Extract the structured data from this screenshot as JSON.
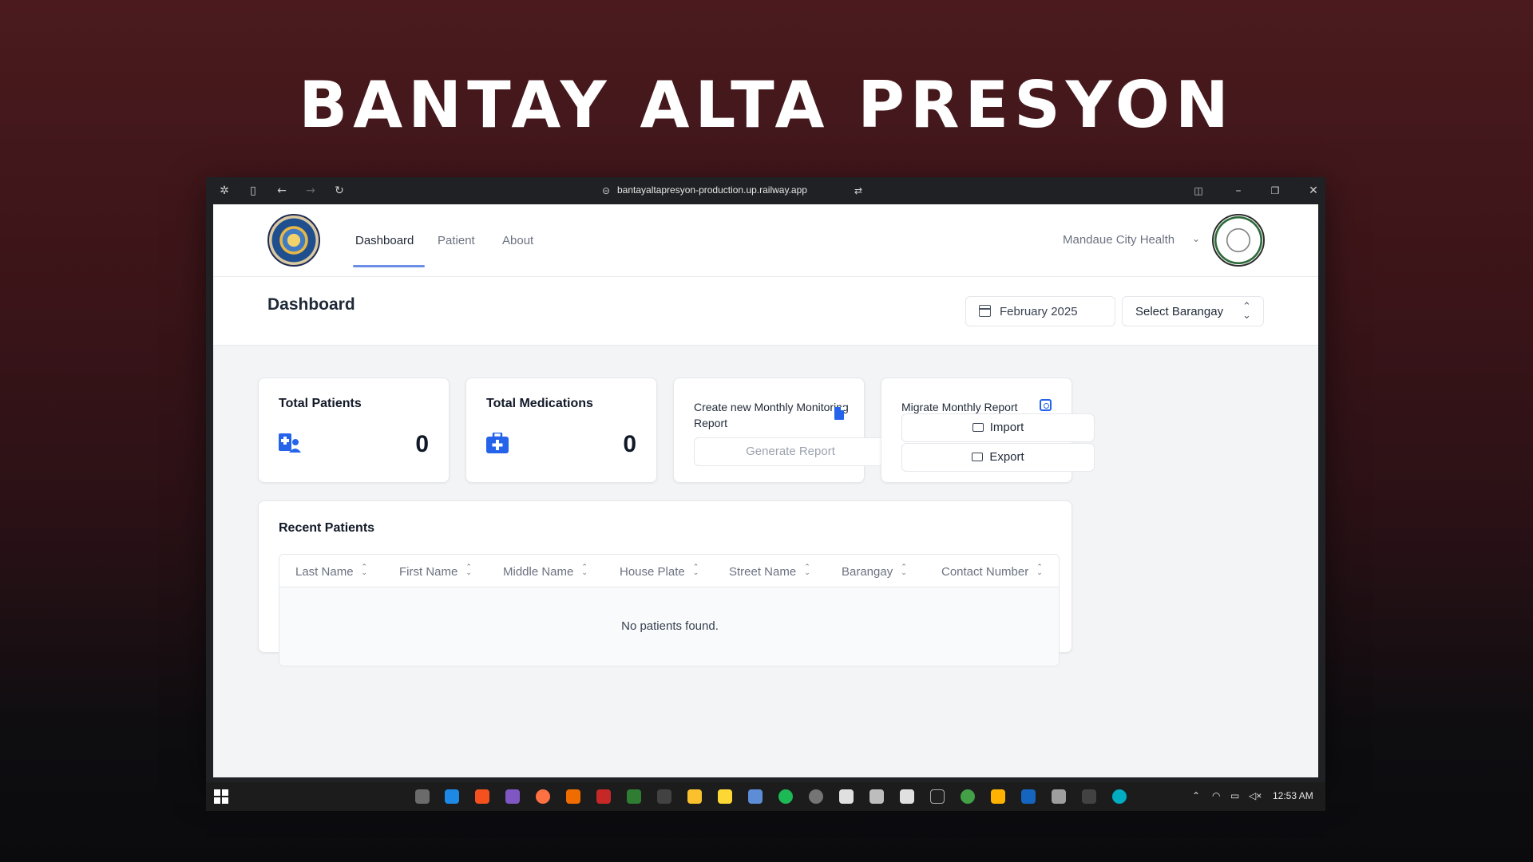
{
  "banner": {
    "title": "BANTAY ALTA PRESYON"
  },
  "browser": {
    "url": "bantayaltapresyon-production.up.railway.app"
  },
  "nav": {
    "links": [
      "Dashboard",
      "Patient",
      "About"
    ],
    "active": "Dashboard",
    "org": "Mandaue City Health"
  },
  "header": {
    "title": "Dashboard",
    "date": "February 2025",
    "barangay_placeholder": "Select Barangay"
  },
  "cards": {
    "total_patients": {
      "label": "Total Patients",
      "value": "0"
    },
    "total_medications": {
      "label": "Total Medications",
      "value": "0"
    },
    "monthly_report": {
      "label": "Create new Monthly Monitoring Report",
      "button": "Generate Report"
    },
    "migrate": {
      "label": "Migrate Monthly Report",
      "import": "Import",
      "export": "Export"
    }
  },
  "recent_patients": {
    "title": "Recent Patients",
    "columns": [
      "Last Name",
      "First Name",
      "Middle Name",
      "House Plate",
      "Street Name",
      "Barangay",
      "Contact Number"
    ],
    "empty_message": "No patients found."
  },
  "taskbar": {
    "time": "12:53 AM"
  },
  "colors": {
    "accent": "#2563eb",
    "nav_underline": "#6b8ee6",
    "banner_bg": "#3a1418"
  }
}
